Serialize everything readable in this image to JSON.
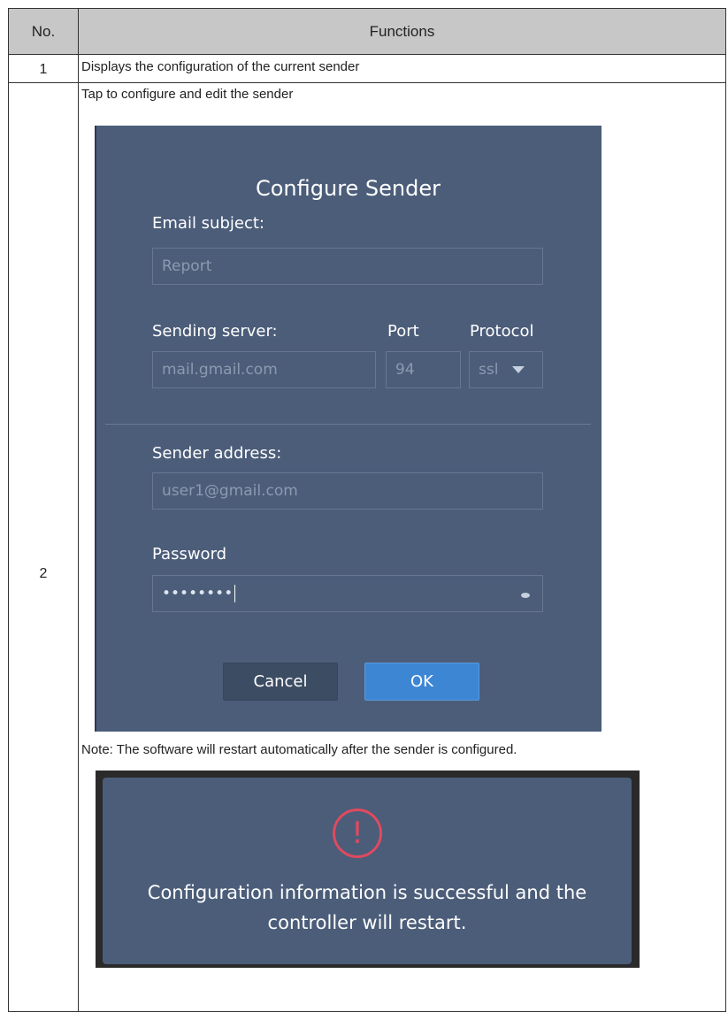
{
  "table": {
    "header": {
      "no": "No.",
      "functions": "Functions"
    },
    "rows": [
      {
        "no": "1",
        "text": "Displays the configuration of the current sender"
      },
      {
        "no": "2",
        "text": "Tap to configure and edit the sender",
        "note": "Note: The software will restart automatically after the sender is configured."
      }
    ]
  },
  "dialog": {
    "title": "Configure Sender",
    "email_subject_label": "Email subject:",
    "email_subject_value": "Report",
    "sending_server_label": "Sending server:",
    "sending_server_value": "mail.gmail.com",
    "port_label": "Port",
    "port_value": "94",
    "protocol_label": "Protocol",
    "protocol_value": "ssl",
    "sender_address_label": "Sender address:",
    "sender_address_value": "user1@gmail.com",
    "password_label": "Password",
    "password_value": "••••••••",
    "cancel_label": "Cancel",
    "ok_label": "OK"
  },
  "restart_dialog": {
    "icon": "warning-icon",
    "icon_glyph": "!",
    "line1": "Configuration information is successful and the",
    "line2": "controller will restart."
  },
  "colors": {
    "dialog_bg": "#4b5d79",
    "ok_button": "#3d86d4",
    "warning": "#e04a5f",
    "header_bg": "#c7c7c7"
  }
}
